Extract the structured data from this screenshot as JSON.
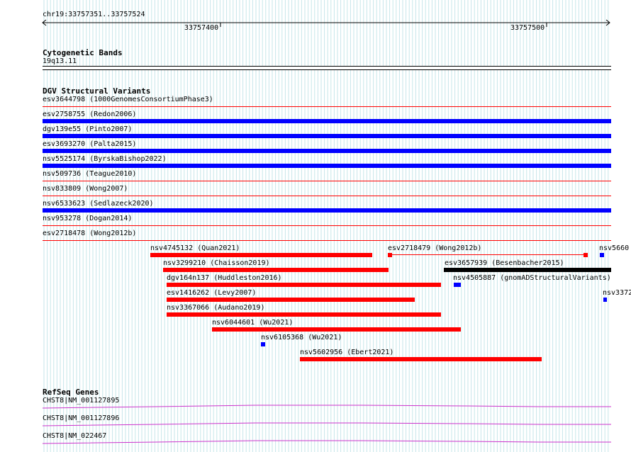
{
  "ruler": {
    "location": "chr19:33757351..33757524",
    "ticks": [
      "33757400",
      "33757500"
    ]
  },
  "cytoband": {
    "title": "Cytogenetic Bands",
    "band": "19q13.11"
  },
  "dgv": {
    "title": "DGV Structural Variants",
    "stacked": [
      {
        "label": "esv3644798 (1000GenomesConsortiumPhase3)",
        "color": "#ff0000",
        "full": false
      },
      {
        "label": "esv2758755 (Redon2006)",
        "color": "#0000ff",
        "full": true
      },
      {
        "label": "dgv139e55 (Pinto2007)",
        "color": "#0000ff",
        "full": true
      },
      {
        "label": "esv3693270 (Palta2015)",
        "color": "#0000ff",
        "full": true
      },
      {
        "label": "nsv5525174 (ByrskaBishop2022)",
        "color": "#0000ff",
        "full": true
      },
      {
        "label": "nsv509736 (Teague2010)",
        "color": "#ff0000",
        "full": false
      },
      {
        "label": "nsv833809 (Wong2007)",
        "color": "#ff0000",
        "full": false
      },
      {
        "label": "nsv6533623 (Sedlazeck2020)",
        "color": "#0000ff",
        "full": true
      },
      {
        "label": "nsv953278 (Dogan2014)",
        "color": "#ff0000",
        "full": false
      },
      {
        "label": "esv2718478 (Wong2012b)",
        "color": "#ff0000",
        "full": false
      }
    ],
    "features": [
      {
        "label": "nsv4745132 (Quan2021)",
        "color": "#ff0000"
      },
      {
        "label": "esv2718479 (Wong2012b)",
        "color": "#ff0000"
      },
      {
        "label": "nsv5660",
        "color": "#0000ff"
      },
      {
        "label": "nsv3299210 (Chaisson2019)",
        "color": "#ff0000"
      },
      {
        "label": "esv3657939 (Besenbacher2015)",
        "color": "#000000"
      },
      {
        "label": "dgv164n137 (Huddleston2016)",
        "color": "#ff0000"
      },
      {
        "label": "nsv4505887 (gnomADStructuralVariants)",
        "color": "#0000ff"
      },
      {
        "label": "esv1416262 (Levy2007)",
        "color": "#ff0000"
      },
      {
        "label": "nsv3372",
        "color": "#0000ff"
      },
      {
        "label": "nsv3367066 (Audano2019)",
        "color": "#ff0000"
      },
      {
        "label": "nsv6044601 (Wu2021)",
        "color": "#ff0000"
      },
      {
        "label": "nsv6105368 (Wu2021)",
        "color": "#0000ff"
      },
      {
        "label": "nsv5602956 (Ebert2021)",
        "color": "#ff0000"
      }
    ]
  },
  "refseq": {
    "title": "RefSeq Genes",
    "genes": [
      {
        "label": "CHST8|NM_001127895",
        "color": "#cc33cc"
      },
      {
        "label": "CHST8|NM_001127896",
        "color": "#cc33cc"
      },
      {
        "label": "CHST8|NM_022467",
        "color": "#cc33cc"
      }
    ]
  }
}
